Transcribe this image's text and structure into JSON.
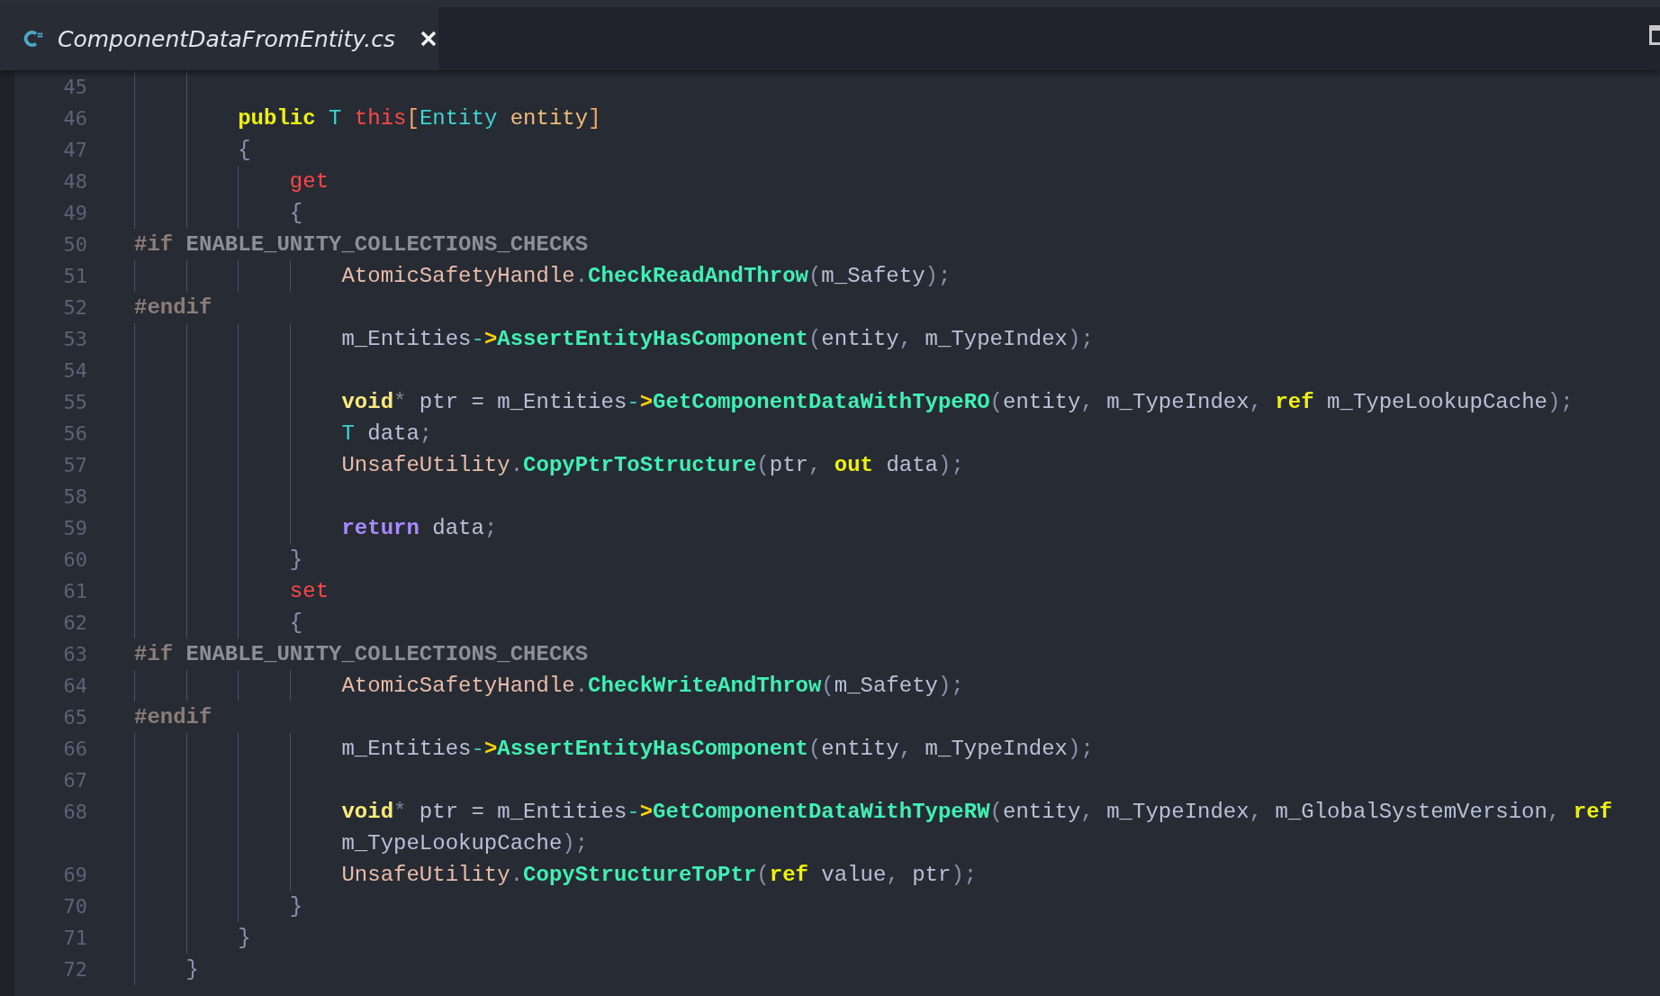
{
  "tabs": [
    {
      "label": "ComponentDataFromEntity.cs",
      "selected": true
    }
  ],
  "editor": {
    "lines": [
      {
        "children": [
          {
            "children": [
              {
                "number": "45"
              },
              {
                "number": "46",
                "tokens": [
                  {
                    "t": "public ",
                    "kind": "keyword"
                  },
                  {
                    "t": "T ",
                    "kind": "type"
                  },
                  {
                    "t": "this",
                    "kind": "accessor"
                  },
                  {
                    "t": "[",
                    "kind": "bracket"
                  },
                  {
                    "t": "Entity ",
                    "kind": "type"
                  },
                  {
                    "t": "entity",
                    "kind": "param"
                  },
                  {
                    "t": "]",
                    "kind": "bracket"
                  }
                ]
              },
              {
                "number": "47",
                "tokens": [
                  {
                    "t": "{",
                    "kind": "punct"
                  }
                ]
              },
              {
                "children": [
                  {
                    "number": "48",
                    "tokens": [
                      {
                        "t": "get",
                        "kind": "accessor"
                      }
                    ]
                  },
                  {
                    "number": "49",
                    "tokens": [
                      {
                        "t": "{",
                        "kind": "punct"
                      }
                    ]
                  }
                ]
              }
            ]
          }
        ]
      },
      {
        "number": "50",
        "tokens": [
          {
            "t": "#if",
            "kind": "directive"
          },
          {
            "t": " ENABLE_UNITY_COLLECTIONS_CHECKS",
            "kind": "symbol"
          }
        ]
      },
      {
        "children": [
          {
            "children": [
              {
                "children": [
                  {
                    "children": [
                      {
                        "number": "51",
                        "tokens": [
                          {
                            "t": "AtomicSafetyHandle",
                            "kind": "class"
                          },
                          {
                            "t": ".",
                            "kind": "punct"
                          },
                          {
                            "t": "CheckReadAndThrow",
                            "kind": "method"
                          },
                          {
                            "t": "(",
                            "kind": "punct"
                          },
                          {
                            "t": "m_Safety",
                            "kind": "ident"
                          },
                          {
                            "t": ");",
                            "kind": "punct"
                          }
                        ]
                      }
                    ]
                  }
                ]
              }
            ]
          }
        ]
      },
      {
        "number": "52",
        "tokens": [
          {
            "t": "#endif",
            "kind": "directive"
          }
        ]
      },
      {
        "children": [
          {
            "children": [
              {
                "children": [
                  {
                    "children": [
                      {
                        "number": "53",
                        "tokens": [
                          {
                            "t": "m_Entities",
                            "kind": "ident"
                          },
                          {
                            "t": "->",
                            "kind": "arrow"
                          },
                          {
                            "t": "AssertEntityHasComponent",
                            "kind": "method"
                          },
                          {
                            "t": "(",
                            "kind": "punct"
                          },
                          {
                            "t": "entity",
                            "kind": "ident"
                          },
                          {
                            "t": ", ",
                            "kind": "punct"
                          },
                          {
                            "t": "m_TypeIndex",
                            "kind": "ident"
                          },
                          {
                            "t": ");",
                            "kind": "punct"
                          }
                        ]
                      },
                      {
                        "number": "54"
                      },
                      {
                        "number": "55",
                        "tokens": [
                          {
                            "t": "void",
                            "kind": "primitive"
                          },
                          {
                            "t": "*",
                            "kind": "op"
                          },
                          {
                            "t": " ptr = m_Entities",
                            "kind": "ident"
                          },
                          {
                            "t": "->",
                            "kind": "arrow"
                          },
                          {
                            "t": "GetComponentDataWithTypeRO",
                            "kind": "method"
                          },
                          {
                            "t": "(",
                            "kind": "punct"
                          },
                          {
                            "t": "entity",
                            "kind": "ident"
                          },
                          {
                            "t": ", ",
                            "kind": "punct"
                          },
                          {
                            "t": "m_TypeIndex",
                            "kind": "ident"
                          },
                          {
                            "t": ", ",
                            "kind": "punct"
                          },
                          {
                            "t": "ref",
                            "kind": "keyword"
                          },
                          {
                            "t": " m_TypeLookupCache",
                            "kind": "ident"
                          },
                          {
                            "t": ");",
                            "kind": "punct"
                          }
                        ]
                      },
                      {
                        "number": "56",
                        "tokens": [
                          {
                            "t": "T",
                            "kind": "type"
                          },
                          {
                            "t": " data",
                            "kind": "ident"
                          },
                          {
                            "t": ";",
                            "kind": "punct"
                          }
                        ]
                      },
                      {
                        "number": "57",
                        "tokens": [
                          {
                            "t": "UnsafeUtility",
                            "kind": "class"
                          },
                          {
                            "t": ".",
                            "kind": "punct"
                          },
                          {
                            "t": "CopyPtrToStructure",
                            "kind": "method"
                          },
                          {
                            "t": "(",
                            "kind": "punct"
                          },
                          {
                            "t": "ptr",
                            "kind": "ident"
                          },
                          {
                            "t": ", ",
                            "kind": "punct"
                          },
                          {
                            "t": "out",
                            "kind": "keyword"
                          },
                          {
                            "t": " data",
                            "kind": "ident"
                          },
                          {
                            "t": ");",
                            "kind": "punct"
                          }
                        ]
                      },
                      {
                        "number": "58"
                      },
                      {
                        "number": "59",
                        "tokens": [
                          {
                            "t": "return",
                            "kind": "control"
                          },
                          {
                            "t": " data",
                            "kind": "ident"
                          },
                          {
                            "t": ";",
                            "kind": "punct"
                          }
                        ]
                      }
                    ]
                  },
                  {
                    "number": "60",
                    "tokens": [
                      {
                        "t": "}",
                        "kind": "punct"
                      }
                    ]
                  },
                  {
                    "number": "61",
                    "tokens": [
                      {
                        "t": "set",
                        "kind": "accessor"
                      }
                    ]
                  },
                  {
                    "number": "62",
                    "tokens": [
                      {
                        "t": "{",
                        "kind": "punct"
                      }
                    ]
                  }
                ]
              }
            ]
          }
        ]
      },
      {
        "number": "63",
        "tokens": [
          {
            "t": "#if",
            "kind": "directive"
          },
          {
            "t": " ENABLE_UNITY_COLLECTIONS_CHECKS",
            "kind": "symbol"
          }
        ]
      },
      {
        "children": [
          {
            "children": [
              {
                "children": [
                  {
                    "children": [
                      {
                        "number": "64",
                        "tokens": [
                          {
                            "t": "AtomicSafetyHandle",
                            "kind": "class"
                          },
                          {
                            "t": ".",
                            "kind": "punct"
                          },
                          {
                            "t": "CheckWriteAndThrow",
                            "kind": "method"
                          },
                          {
                            "t": "(",
                            "kind": "punct"
                          },
                          {
                            "t": "m_Safety",
                            "kind": "ident"
                          },
                          {
                            "t": ");",
                            "kind": "punct"
                          }
                        ]
                      }
                    ]
                  }
                ]
              }
            ]
          }
        ]
      },
      {
        "number": "65",
        "tokens": [
          {
            "t": "#endif",
            "kind": "directive"
          }
        ]
      },
      {
        "children": [
          {
            "children": [
              {
                "children": [
                  {
                    "children": [
                      {
                        "number": "66",
                        "tokens": [
                          {
                            "t": "m_Entities",
                            "kind": "ident"
                          },
                          {
                            "t": "->",
                            "kind": "arrow"
                          },
                          {
                            "t": "AssertEntityHasComponent",
                            "kind": "method"
                          },
                          {
                            "t": "(",
                            "kind": "punct"
                          },
                          {
                            "t": "entity",
                            "kind": "ident"
                          },
                          {
                            "t": ", ",
                            "kind": "punct"
                          },
                          {
                            "t": "m_TypeIndex",
                            "kind": "ident"
                          },
                          {
                            "t": ");",
                            "kind": "punct"
                          }
                        ]
                      },
                      {
                        "number": "67"
                      },
                      {
                        "number": "68",
                        "tokens": [
                          {
                            "t": "void",
                            "kind": "primitive"
                          },
                          {
                            "t": "*",
                            "kind": "op"
                          },
                          {
                            "t": " ptr = m_Entities",
                            "kind": "ident"
                          },
                          {
                            "t": "->",
                            "kind": "arrow"
                          },
                          {
                            "t": "GetComponentDataWithTypeRW",
                            "kind": "method"
                          },
                          {
                            "t": "(",
                            "kind": "punct"
                          },
                          {
                            "t": "entity",
                            "kind": "ident"
                          },
                          {
                            "t": ", ",
                            "kind": "punct"
                          },
                          {
                            "t": "m_TypeIndex",
                            "kind": "ident"
                          },
                          {
                            "t": ", ",
                            "kind": "punct"
                          },
                          {
                            "t": "m_GlobalSystemVersion",
                            "kind": "ident"
                          },
                          {
                            "t": ", ",
                            "kind": "punct"
                          },
                          {
                            "t": "ref",
                            "kind": "keyword"
                          }
                        ],
                        "wrap_tokens": [
                          {
                            "t": "m_TypeLookupCache",
                            "kind": "ident"
                          },
                          {
                            "t": ");",
                            "kind": "punct"
                          }
                        ]
                      },
                      {
                        "number": "69",
                        "tokens": [
                          {
                            "t": "UnsafeUtility",
                            "kind": "class"
                          },
                          {
                            "t": ".",
                            "kind": "punct"
                          },
                          {
                            "t": "CopyStructureToPtr",
                            "kind": "method"
                          },
                          {
                            "t": "(",
                            "kind": "punct"
                          },
                          {
                            "t": "ref",
                            "kind": "keyword"
                          },
                          {
                            "t": " value",
                            "kind": "ident"
                          },
                          {
                            "t": ", ",
                            "kind": "punct"
                          },
                          {
                            "t": "ptr",
                            "kind": "ident"
                          },
                          {
                            "t": ");",
                            "kind": "punct"
                          }
                        ]
                      }
                    ]
                  },
                  {
                    "number": "70",
                    "tokens": [
                      {
                        "t": "}",
                        "kind": "punct"
                      }
                    ]
                  }
                ]
              },
              {
                "number": "71",
                "tokens": [
                  {
                    "t": "}",
                    "kind": "punct"
                  }
                ]
              }
            ]
          },
          {
            "number": "72",
            "tokens": [
              {
                "t": "}",
                "kind": "punct"
              }
            ]
          }
        ]
      }
    ]
  }
}
